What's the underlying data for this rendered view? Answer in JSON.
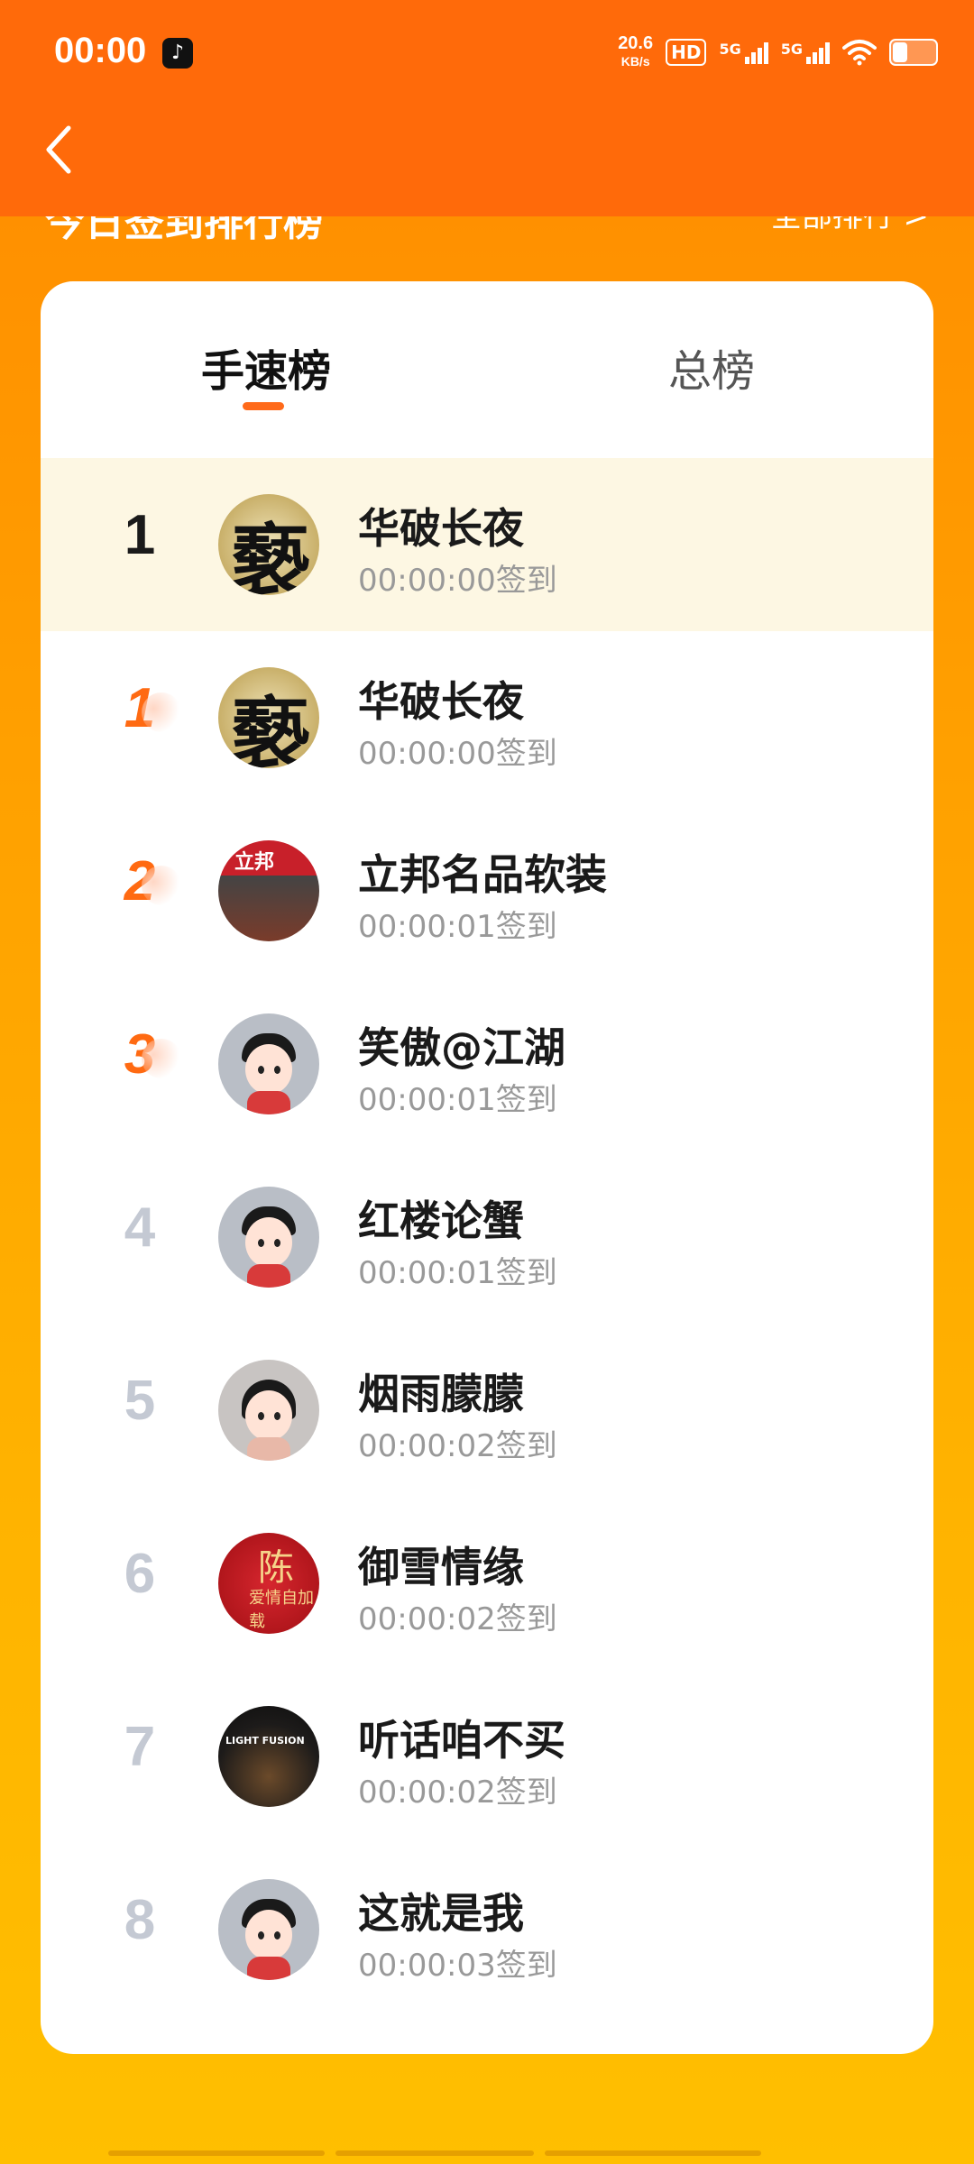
{
  "status": {
    "time": "00:00",
    "net_speed_value": "20.6",
    "net_speed_unit": "KB/s",
    "hd": "HD",
    "sim1": "5G",
    "sim2": "5G"
  },
  "header": {
    "section_title": "今日签到排行榜",
    "all_rank_link": "全部排行 >"
  },
  "tabs": [
    {
      "label": "手速榜",
      "active": true
    },
    {
      "label": "总榜",
      "active": false
    }
  ],
  "my_entry": {
    "rank": "1",
    "name": "华破长夜",
    "time": "00:00:00签到"
  },
  "ranking": [
    {
      "rank": "1",
      "name": "华破长夜",
      "time": "00:00:00签到",
      "avatar": "calligraphy-avatar"
    },
    {
      "rank": "2",
      "name": "立邦名品软装",
      "time": "00:00:01签到",
      "avatar": "shopfront-avatar"
    },
    {
      "rank": "3",
      "name": "笑傲@江湖",
      "time": "00:00:01签到",
      "avatar": "default-cartoon-avatar"
    },
    {
      "rank": "4",
      "name": "红楼论蟹",
      "time": "00:00:01签到",
      "avatar": "default-cartoon-avatar"
    },
    {
      "rank": "5",
      "name": "烟雨朦朦",
      "time": "00:00:02签到",
      "avatar": "cartoon-girl-avatar"
    },
    {
      "rank": "6",
      "name": "御雪情缘",
      "time": "00:00:02签到",
      "avatar": "red-dragon-avatar"
    },
    {
      "rank": "7",
      "name": "听话咱不买",
      "time": "00:00:02签到",
      "avatar": "storefront-night-avatar"
    },
    {
      "rank": "8",
      "name": "这就是我",
      "time": "00:00:03签到",
      "avatar": "default-cartoon-avatar"
    }
  ],
  "avatar_text": {
    "calligraphy": "褻",
    "shop_sign": "立邦",
    "red_char": "陈",
    "red_sub": "爱情自加载",
    "dark_sign": "LIGHT FUSION"
  },
  "colors": {
    "top_bar": "#ff6a0a",
    "accent": "#ff6a1a",
    "highlight_row": "#fdf7e3",
    "muted_rank": "#c4c9d3"
  }
}
